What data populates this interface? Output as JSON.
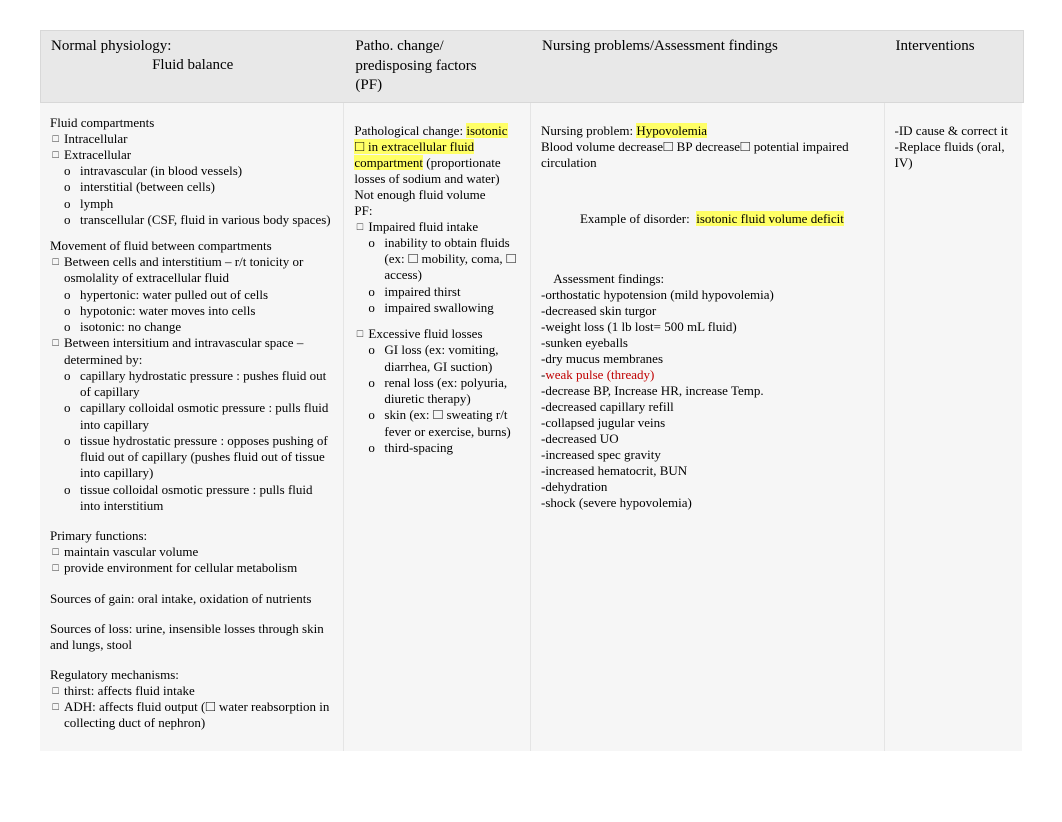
{
  "headers": {
    "col1_line1": "Normal physiology:",
    "col1_line2": "Fluid balance",
    "col2_line1": "Patho. change/",
    "col2_line2": "predisposing factors",
    "col2_line3": "(PF)",
    "col3": "Nursing problems/Assessment findings",
    "col4": "Interventions"
  },
  "col1": {
    "fluid_compartments_title": "Fluid compartments",
    "intracellular": "Intracellular",
    "extracellular": "Extracellular",
    "intravascular": "intravascular (in blood vessels)",
    "interstitial": "interstitial (between cells)",
    "lymph": "lymph",
    "transcellular": "transcellular (CSF, fluid in various body spaces)",
    "movement_title": "Movement of fluid between compartments",
    "between_cells": "Between cells and interstitium – r/t tonicity or osmolality of extracellular fluid",
    "hypertonic": "hypertonic: water pulled out of cells",
    "hypotonic": "hypotonic: water moves into cells",
    "isotonic": "isotonic: no change",
    "between_inter": "Between intersitium and intravascular space – determined by:",
    "cap_hydrostatic": "capillary hydrostatic pressure : pushes fluid out of capillary",
    "cap_colloidal": "capillary colloidal osmotic pressure : pulls fluid into capillary",
    "tissue_hydrostatic": "tissue hydrostatic pressure : opposes pushing of fluid out of capillary (pushes fluid out of tissue into capillary)",
    "tissue_colloidal": "tissue colloidal osmotic pressure : pulls fluid into interstitium",
    "primary_title": "Primary functions:",
    "primary1": "maintain vascular volume",
    "primary2": "provide environment for cellular metabolism",
    "sources_gain": "Sources of gain:  oral intake, oxidation of nutrients",
    "sources_loss": "Sources of loss:  urine, insensible losses through skin and lungs, stool",
    "regulatory_title": "Regulatory mechanisms:",
    "reg1": "thirst: affects fluid intake",
    "reg2": "ADH: affects fluid output (🞎 water reabsorption in collecting duct of nephron)"
  },
  "col2": {
    "patho_prefix": "Pathological change:   ",
    "patho_hl": "isotonic 🞎 in extracellular fluid compartment",
    "patho_suffix": " (proportionate losses of sodium and water)  Not enough fluid volume",
    "pf_label": "PF:",
    "impaired_intake": "Impaired fluid intake",
    "inability": "inability to obtain fluids (ex: 🞎 mobility, coma, 🞎 access)",
    "impaired_thirst": "impaired thirst",
    "impaired_swallow": "impaired swallowing",
    "excessive": "Excessive fluid losses",
    "gi_loss": "GI loss (ex: vomiting, diarrhea, GI suction)",
    "renal_loss": "renal loss (ex: polyuria, diuretic therapy)",
    "skin_loss": "skin (ex: 🞎 sweating r/t fever or exercise, burns)",
    "third_spacing": "third-spacing"
  },
  "col3": {
    "np_prefix": "Nursing problem:  ",
    "np_hl": "Hypovolemia",
    "blood_vol": "Blood volume decrease🞎 BP decrease🞎 potential impaired circulation",
    "example_prefix": "    Example of disorder:  ",
    "example_hl": "isotonic fluid volume deficit",
    "assess_title": "    Assessment findings:",
    "a1": "-orthostatic hypotension (mild hypovolemia)",
    "a2": "-decreased skin turgor",
    "a3": "-weight loss (1 lb lost= 500 mL fluid)",
    "a4": "-sunken eyeballs",
    "a5": "-dry mucus membranes",
    "a6_pref": "-",
    "a6_red": "weak pulse (thready)",
    "a7": "-decrease BP, Increase HR, increase Temp.",
    "a8": "-decreased capillary refill",
    "a9": "-collapsed jugular veins",
    "a10": "-decreased UO",
    "a11": "-increased spec gravity",
    "a12": "-increased hematocrit, BUN",
    "a13": "-dehydration",
    "a14": "-shock (severe hypovolemia)"
  },
  "col4": {
    "i1": "-ID cause & correct it",
    "i2": "-Replace fluids (oral, IV)"
  }
}
